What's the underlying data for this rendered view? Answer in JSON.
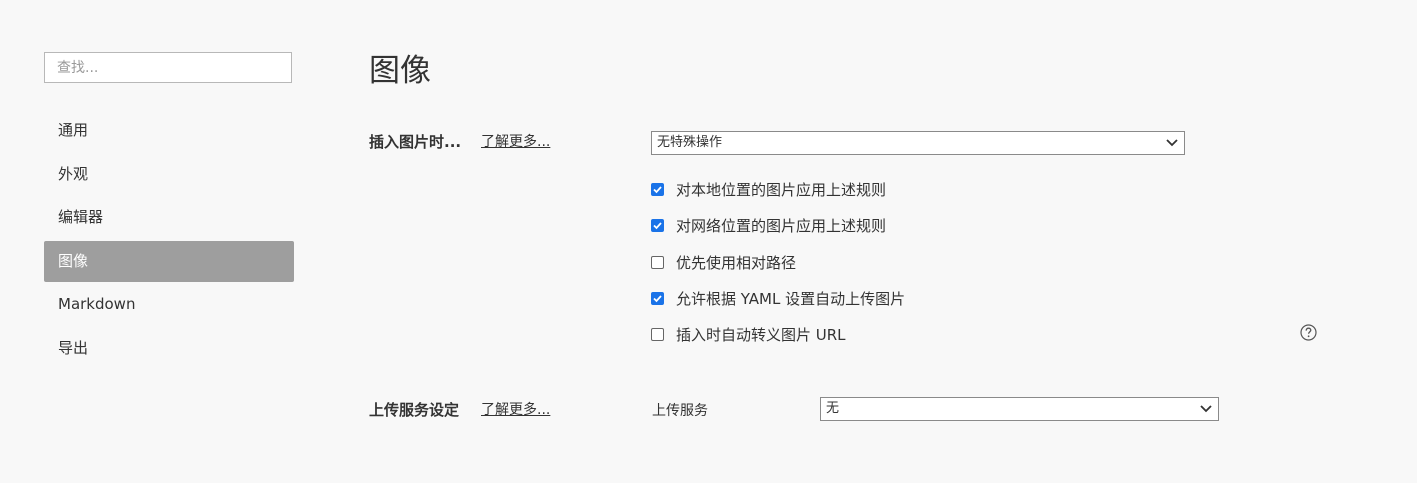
{
  "search": {
    "placeholder": "查找..."
  },
  "sidebar": {
    "items": [
      {
        "label": "通用"
      },
      {
        "label": "外观"
      },
      {
        "label": "编辑器"
      },
      {
        "label": "图像"
      },
      {
        "label": "Markdown"
      },
      {
        "label": "导出"
      }
    ],
    "active_index": 3
  },
  "page": {
    "title": "图像"
  },
  "insert_section": {
    "label": "插入图片时...",
    "learn_more": "了解更多...",
    "action_select": "无特殊操作",
    "options": [
      {
        "label": "对本地位置的图片应用上述规则",
        "checked": true
      },
      {
        "label": "对网络位置的图片应用上述规则",
        "checked": true
      },
      {
        "label": "优先使用相对路径",
        "checked": false
      },
      {
        "label": "允许根据 YAML 设置自动上传图片",
        "checked": true
      },
      {
        "label": "插入时自动转义图片 URL",
        "checked": false
      }
    ],
    "help_icon": "question-circle-icon"
  },
  "upload_section": {
    "label": "上传服务设定",
    "learn_more": "了解更多...",
    "service_label": "上传服务",
    "service_select": "无"
  },
  "colors": {
    "accent": "#1a73e8",
    "active_nav_bg": "#9e9e9e"
  }
}
